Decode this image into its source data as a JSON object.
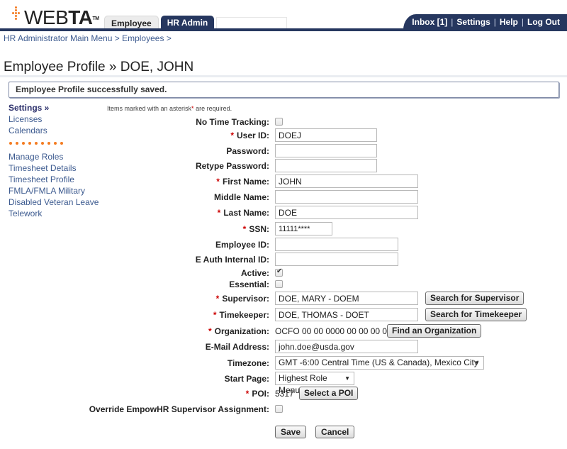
{
  "app": {
    "logo_text_light": "WEB",
    "logo_text_bold": "TA",
    "logo_tm": "TM",
    "brand_color": "#26375f",
    "accent_color": "#f47b20"
  },
  "tabs": [
    {
      "label": "Employee",
      "active": false
    },
    {
      "label": "HR Admin",
      "active": true
    }
  ],
  "user_nav": {
    "inbox": "Inbox [1]",
    "settings": "Settings",
    "help": "Help",
    "logout": "Log Out",
    "separator": "|"
  },
  "breadcrumb": {
    "items": [
      "HR Administrator Main Menu",
      "Employees"
    ],
    "separator": ">"
  },
  "page_title": "Employee Profile » DOE, JOHN",
  "alert_message": "Employee Profile successfully saved.",
  "sidebar": {
    "group1": [
      {
        "label": "Settings »",
        "active": true
      },
      {
        "label": "Licenses",
        "active": false
      },
      {
        "label": "Calendars",
        "active": false
      }
    ],
    "group2": [
      {
        "label": "Manage Roles"
      },
      {
        "label": "Timesheet Details"
      },
      {
        "label": "Timesheet Profile"
      },
      {
        "label": "FMLA/FMLA Military"
      },
      {
        "label": "Disabled Veteran Leave"
      },
      {
        "label": "Telework"
      }
    ]
  },
  "required_note": {
    "before": "Items marked with an asterisk",
    "star": "*",
    "after": " are required."
  },
  "form": {
    "no_time_tracking": {
      "label": "No Time Tracking:",
      "checked": false
    },
    "user_id": {
      "label": "User ID:",
      "value": "DOEJ",
      "required": true
    },
    "password": {
      "label": "Password:",
      "value": ""
    },
    "retype_password": {
      "label": "Retype Password:",
      "value": ""
    },
    "first_name": {
      "label": "First Name:",
      "value": "JOHN",
      "required": true
    },
    "middle_name": {
      "label": "Middle Name:",
      "value": ""
    },
    "last_name": {
      "label": "Last Name:",
      "value": "DOE",
      "required": true
    },
    "ssn": {
      "label": "SSN:",
      "value": "11111****",
      "required": true
    },
    "employee_id": {
      "label": "Employee ID:",
      "value": ""
    },
    "e_auth_id": {
      "label": "E Auth Internal ID:",
      "value": ""
    },
    "active": {
      "label": "Active:",
      "checked": true
    },
    "essential": {
      "label": "Essential:",
      "checked": false
    },
    "supervisor": {
      "label": "Supervisor:",
      "value": "DOE, MARY - DOEM",
      "required": true,
      "button": "Search for Supervisor"
    },
    "timekeeper": {
      "label": "Timekeeper:",
      "value": "DOE, THOMAS - DOET",
      "required": true,
      "button": "Search for Timekeeper"
    },
    "organization": {
      "label": "Organization:",
      "value": "OCFO 00 00 0000 00 00 00 00",
      "required": true,
      "button": "Find an Organization"
    },
    "email": {
      "label": "E-Mail Address:",
      "value": "john.doe@usda.gov"
    },
    "timezone": {
      "label": "Timezone:",
      "selected": "GMT -6:00 Central Time (US & Canada), Mexico City"
    },
    "start_page": {
      "label": "Start Page:",
      "selected": "Highest Role Menu"
    },
    "poi": {
      "label": "POI:",
      "value": "5317",
      "required": true,
      "button": "Select a POI"
    },
    "override_empowhr": {
      "label": "Override EmpowHR Supervisor Assignment:",
      "checked": false
    }
  },
  "actions": {
    "save": "Save",
    "cancel": "Cancel"
  },
  "icons": {
    "dropdown_arrow": "▼",
    "required_star": "*"
  }
}
